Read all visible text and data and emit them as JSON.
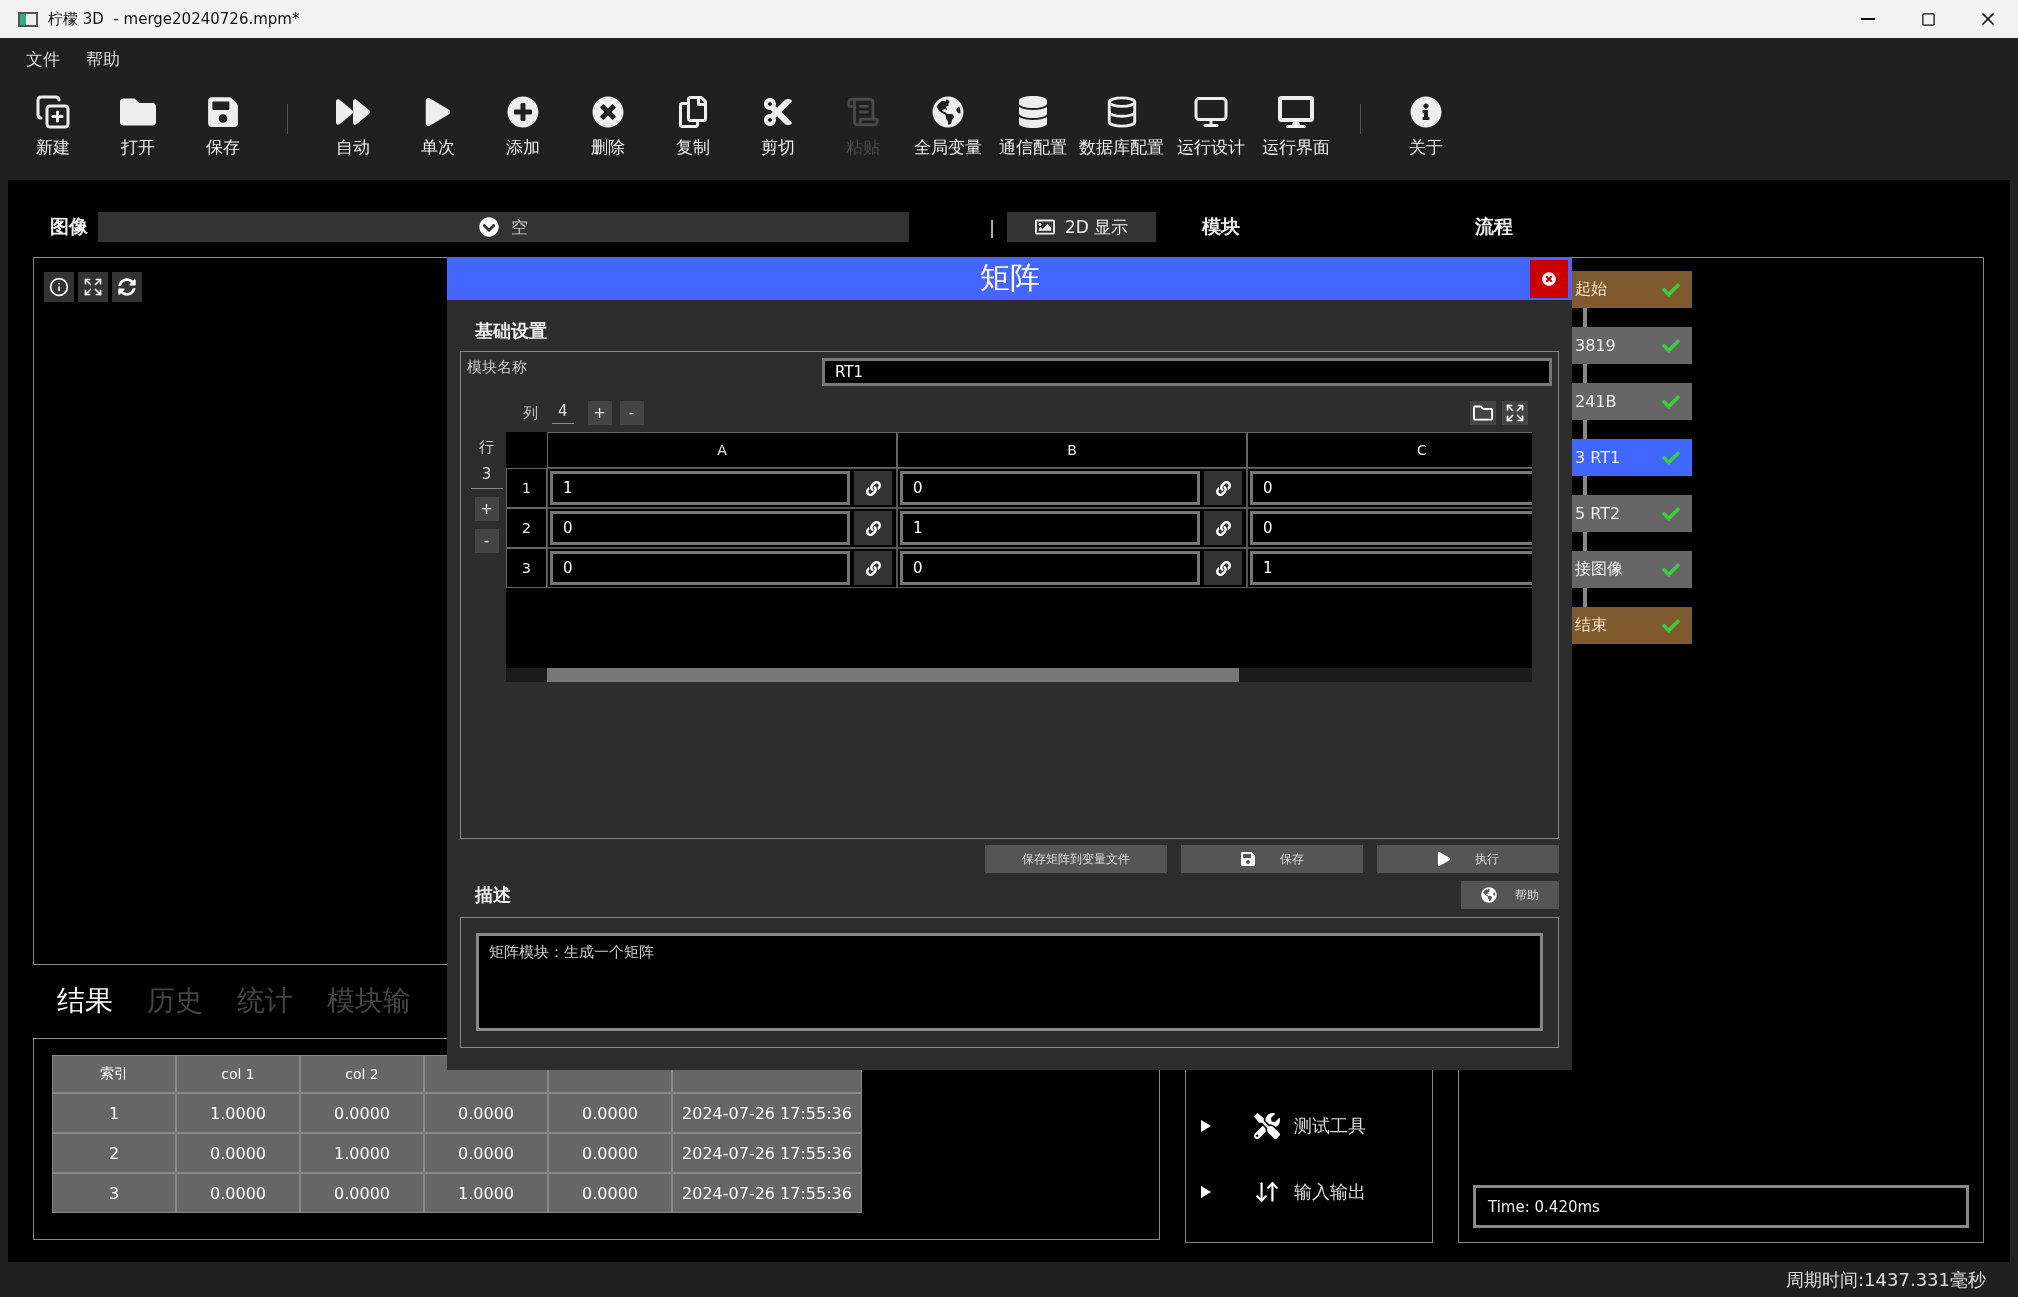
{
  "window": {
    "title": "柠檬 3D  - merge20240726.mpm*"
  },
  "menu": [
    {
      "label": "文件"
    },
    {
      "label": "帮助"
    }
  ],
  "toolbar_groups": [
    [
      {
        "label": "新建",
        "disabled": false
      },
      {
        "label": "打开",
        "disabled": false
      },
      {
        "label": "保存",
        "disabled": false
      }
    ],
    [
      {
        "label": "自动",
        "disabled": false
      },
      {
        "label": "单次",
        "disabled": false
      },
      {
        "label": "添加",
        "disabled": false
      },
      {
        "label": "删除",
        "disabled": false
      },
      {
        "label": "复制",
        "disabled": false
      },
      {
        "label": "剪切",
        "disabled": false
      },
      {
        "label": "粘贴",
        "disabled": true
      },
      {
        "label": "全局变量",
        "disabled": false
      },
      {
        "label": "通信配置",
        "disabled": false
      },
      {
        "label": "数据库配置",
        "disabled": false
      },
      {
        "label": "运行设计",
        "disabled": false
      },
      {
        "label": "运行界面",
        "disabled": false
      }
    ],
    [
      {
        "label": "关于",
        "disabled": false
      }
    ]
  ],
  "image_panel": {
    "label": "图像",
    "source": "空",
    "separator": "|",
    "view_button": "2D 显示"
  },
  "results": {
    "tabs": [
      {
        "label": "结果",
        "selected": true
      },
      {
        "label": "历史",
        "selected": false
      },
      {
        "label": "统计",
        "selected": false
      },
      {
        "label": "模块输",
        "selected": false
      }
    ],
    "table": {
      "columns": [
        "索引",
        "col 1",
        "col 2"
      ],
      "rows": [
        [
          "1",
          "1.0000",
          "0.0000",
          "0.0000",
          "0.0000",
          "2024-07-26 17:55:36"
        ],
        [
          "2",
          "0.0000",
          "1.0000",
          "0.0000",
          "0.0000",
          "2024-07-26 17:55:36"
        ],
        [
          "3",
          "0.0000",
          "0.0000",
          "1.0000",
          "0.0000",
          "2024-07-26 17:55:36"
        ]
      ]
    }
  },
  "modules": {
    "title": "模块",
    "items": [
      {
        "label": "测试工具",
        "expanded": false
      },
      {
        "label": "输入输出",
        "expanded": false
      }
    ]
  },
  "flow": {
    "title": "流程",
    "nodes": [
      {
        "label": "起始",
        "kind": "terminal",
        "selected": false,
        "ok": true
      },
      {
        "label": "3819",
        "kind": "module",
        "selected": false,
        "ok": true
      },
      {
        "label": "241B",
        "kind": "module",
        "selected": false,
        "ok": true
      },
      {
        "label": "3 RT1",
        "kind": "module",
        "selected": true,
        "ok": true
      },
      {
        "label": "5 RT2",
        "kind": "module",
        "selected": false,
        "ok": true
      },
      {
        "label": "接图像",
        "kind": "module",
        "selected": false,
        "ok": true
      },
      {
        "label": "结束",
        "kind": "terminal",
        "selected": false,
        "ok": true
      }
    ],
    "time": "Time: 0.420ms"
  },
  "dialog": {
    "title": "矩阵",
    "section": "基础设置",
    "name_label": "模块名称",
    "name_value": "RT1",
    "col_label": "列",
    "col_count": "4",
    "col_plus": "+",
    "col_minus": "-",
    "row_label": "行",
    "row_count": "3",
    "row_plus": "+",
    "row_minus": "-",
    "matrix": {
      "columns": [
        "A",
        "B",
        "C"
      ],
      "rows": [
        {
          "label": "1",
          "cells": [
            "1",
            "0",
            "0"
          ]
        },
        {
          "label": "2",
          "cells": [
            "0",
            "1",
            "0"
          ]
        },
        {
          "label": "3",
          "cells": [
            "0",
            "0",
            "1"
          ]
        }
      ]
    },
    "buttons": [
      {
        "label": "保存矩阵到变量文件"
      },
      {
        "label": "保存"
      },
      {
        "label": "执行"
      }
    ],
    "description_title": "描述",
    "help_button": "帮助",
    "description": "矩阵模块：生成一个矩阵"
  },
  "status_bar": {
    "cycle_time": "周期时间:1437.331毫秒"
  }
}
